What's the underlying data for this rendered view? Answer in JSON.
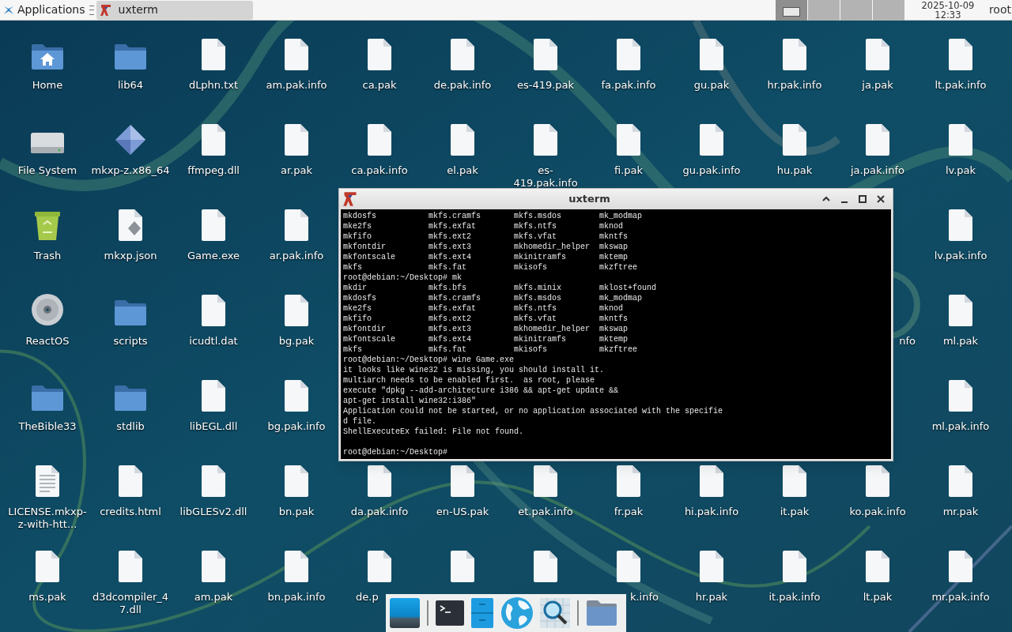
{
  "top_panel": {
    "menu": "Applications",
    "tasks": [
      {
        "title": "uxterm",
        "selected": true
      }
    ],
    "workspaces": [
      {
        "selected": true
      },
      {
        "selected": false
      },
      {
        "selected": false
      },
      {
        "selected": false
      }
    ],
    "clock": {
      "date": "2025-10-09",
      "time": "12:33"
    },
    "user": "root"
  },
  "desktop": {
    "rows": [
      [
        {
          "label": "Home",
          "kind": "home"
        },
        {
          "label": "lib64",
          "kind": "folder"
        },
        {
          "label": "dLphn.txt",
          "kind": "file"
        },
        {
          "label": "am.pak.info",
          "kind": "file"
        },
        {
          "label": "ca.pak",
          "kind": "file"
        },
        {
          "label": "de.pak.info",
          "kind": "file"
        },
        {
          "label": "es-419.pak",
          "kind": "file"
        },
        {
          "label": "fa.pak.info",
          "kind": "file"
        },
        {
          "label": "gu.pak",
          "kind": "file"
        },
        {
          "label": "hr.pak.info",
          "kind": "file"
        },
        {
          "label": "ja.pak",
          "kind": "file"
        },
        {
          "label": "lt.pak.info",
          "kind": "file"
        }
      ],
      [
        {
          "label": "File System",
          "kind": "drive"
        },
        {
          "label": "mkxp-z.x86_64",
          "kind": "app"
        },
        {
          "label": "ffmpeg.dll",
          "kind": "file"
        },
        {
          "label": "ar.pak",
          "kind": "file"
        },
        {
          "label": "ca.pak.info",
          "kind": "file"
        },
        {
          "label": "el.pak",
          "kind": "file"
        },
        {
          "label": "es-419.pak.info",
          "kind": "file"
        },
        {
          "label": "fi.pak",
          "kind": "file"
        },
        {
          "label": "gu.pak.info",
          "kind": "file"
        },
        {
          "label": "hu.pak",
          "kind": "file"
        },
        {
          "label": "ja.pak.info",
          "kind": "file"
        },
        {
          "label": "lv.pak",
          "kind": "file"
        }
      ],
      [
        {
          "label": "Trash",
          "kind": "trash"
        },
        {
          "label": "mkxp.json",
          "kind": "json"
        },
        {
          "label": "Game.exe",
          "kind": "file"
        },
        {
          "label": "ar.pak.info",
          "kind": "file"
        },
        null,
        null,
        null,
        null,
        null,
        null,
        null,
        {
          "label": "lv.pak.info",
          "kind": "file"
        }
      ],
      [
        {
          "label": "ReactOS",
          "kind": "disc"
        },
        {
          "label": "scripts",
          "kind": "folder"
        },
        {
          "label": "icudtl.dat",
          "kind": "file"
        },
        {
          "label": "bg.pak",
          "kind": "file"
        },
        null,
        null,
        null,
        null,
        null,
        null,
        {
          "label": "nfo",
          "kind": "label-tail"
        },
        {
          "label": "ml.pak",
          "kind": "file"
        }
      ],
      [
        {
          "label": "TheBible33",
          "kind": "folder"
        },
        {
          "label": "stdlib",
          "kind": "folder"
        },
        {
          "label": "libEGL.dll",
          "kind": "file"
        },
        {
          "label": "bg.pak.info",
          "kind": "file"
        },
        null,
        null,
        null,
        null,
        null,
        null,
        null,
        {
          "label": "ml.pak.info",
          "kind": "file"
        }
      ],
      [
        {
          "label": "LICENSE.mkxp-z-with-htt...",
          "kind": "document"
        },
        {
          "label": "credits.html",
          "kind": "file"
        },
        {
          "label": "libGLESv2.dll",
          "kind": "file"
        },
        {
          "label": "bn.pak",
          "kind": "file"
        },
        {
          "label": "da.pak.info",
          "kind": "file"
        },
        {
          "label": "en-US.pak",
          "kind": "file"
        },
        {
          "label": "et.pak.info",
          "kind": "file"
        },
        {
          "label": "fr.pak",
          "kind": "file"
        },
        {
          "label": "hi.pak.info",
          "kind": "file"
        },
        {
          "label": "it.pak",
          "kind": "file"
        },
        {
          "label": "ko.pak.info",
          "kind": "file"
        },
        {
          "label": "mr.pak",
          "kind": "file"
        }
      ],
      [
        {
          "label": "ms.pak",
          "kind": "file"
        },
        {
          "label": "d3dcompiler_47.dll",
          "kind": "file"
        },
        {
          "label": "am.pak",
          "kind": "file"
        },
        {
          "label": "bn.pak.info",
          "kind": "file"
        },
        {
          "label": "de.p",
          "kind": "file-head"
        },
        {
          "kind": "file"
        },
        {
          "kind": "file"
        },
        {
          "label": "k.info",
          "kind": "file-tail"
        },
        {
          "label": "hr.pak",
          "kind": "file"
        },
        {
          "label": "it.pak.info",
          "kind": "file"
        },
        {
          "label": "lt.pak",
          "kind": "file"
        },
        {
          "label": "mr.pak.info",
          "kind": "file"
        }
      ]
    ]
  },
  "terminal": {
    "title": "uxterm",
    "lines": [
      {
        "kind": "columns",
        "cells": [
          "mkdosfs",
          "mkfs.cramfs",
          "mkfs.msdos",
          "mk_modmap"
        ]
      },
      {
        "kind": "columns",
        "cells": [
          "mke2fs",
          "mkfs.exfat",
          "mkfs.ntfs",
          "mknod"
        ]
      },
      {
        "kind": "columns",
        "cells": [
          "mkfifo",
          "mkfs.ext2",
          "mkfs.vfat",
          "mkntfs"
        ]
      },
      {
        "kind": "columns",
        "cells": [
          "mkfontdir",
          "mkfs.ext3",
          "mkhomedir_helper",
          "mkswap"
        ]
      },
      {
        "kind": "columns",
        "cells": [
          "mkfontscale",
          "mkfs.ext4",
          "mkinitramfs",
          "mktemp"
        ]
      },
      {
        "kind": "columns",
        "cells": [
          "mkfs",
          "mkfs.fat",
          "mkisofs",
          "mkzftree"
        ]
      },
      {
        "kind": "text",
        "text": "root@debian:~/Desktop# mk"
      },
      {
        "kind": "columns",
        "cells": [
          "mkdir",
          "mkfs.bfs",
          "mkfs.minix",
          "mklost+found"
        ]
      },
      {
        "kind": "columns",
        "cells": [
          "mkdosfs",
          "mkfs.cramfs",
          "mkfs.msdos",
          "mk_modmap"
        ]
      },
      {
        "kind": "columns",
        "cells": [
          "mke2fs",
          "mkfs.exfat",
          "mkfs.ntfs",
          "mknod"
        ]
      },
      {
        "kind": "columns",
        "cells": [
          "mkfifo",
          "mkfs.ext2",
          "mkfs.vfat",
          "mkntfs"
        ]
      },
      {
        "kind": "columns",
        "cells": [
          "mkfontdir",
          "mkfs.ext3",
          "mkhomedir_helper",
          "mkswap"
        ]
      },
      {
        "kind": "columns",
        "cells": [
          "mkfontscale",
          "mkfs.ext4",
          "mkinitramfs",
          "mktemp"
        ]
      },
      {
        "kind": "columns",
        "cells": [
          "mkfs",
          "mkfs.fat",
          "mkisofs",
          "mkzftree"
        ]
      },
      {
        "kind": "text",
        "text": "root@debian:~/Desktop# wine Game.exe"
      },
      {
        "kind": "text",
        "text": "it looks like wine32 is missing, you should install it."
      },
      {
        "kind": "text",
        "text": "multiarch needs to be enabled first.  as root, please"
      },
      {
        "kind": "text",
        "text": "execute \"dpkg --add-architecture i386 && apt-get update &&"
      },
      {
        "kind": "text",
        "text": "apt-get install wine32:i386\""
      },
      {
        "kind": "text",
        "text": "Application could not be started, or no application associated with the specifie"
      },
      {
        "kind": "text",
        "text": "d file."
      },
      {
        "kind": "text",
        "text": "ShellExecuteEx failed: File not found."
      },
      {
        "kind": "blank"
      },
      {
        "kind": "text",
        "text": "root@debian:~/Desktop#"
      }
    ]
  },
  "dock": {
    "items": [
      {
        "kind": "show-desktop"
      },
      {
        "kind": "separator"
      },
      {
        "kind": "terminal"
      },
      {
        "kind": "cabinet"
      },
      {
        "kind": "globe"
      },
      {
        "kind": "search"
      },
      {
        "kind": "separator"
      },
      {
        "kind": "folder"
      }
    ]
  }
}
